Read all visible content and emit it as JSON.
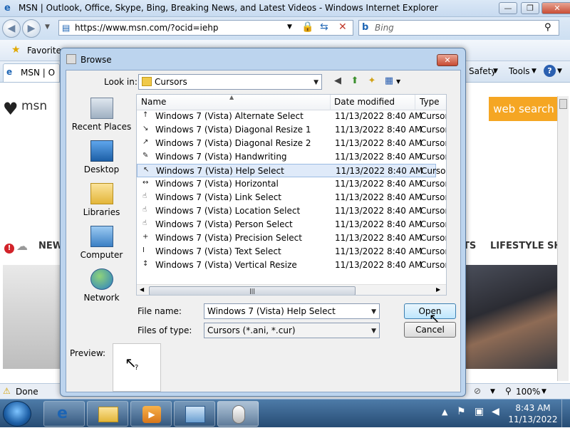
{
  "ie": {
    "title": "MSN | Outlook, Office, Skype, Bing, Breaking News, and Latest Videos - Windows Internet Explorer",
    "url": "https://www.msn.com/?ocid=iehp",
    "search_placeholder": "Bing",
    "favorites_label": "Favorites",
    "tab_label": "MSN | O",
    "safety_label": "Safety",
    "tools_label": "Tools",
    "status": "Done",
    "zoom": "100%"
  },
  "msn": {
    "logo": "msn",
    "web_search_label": "web search",
    "nav_new": "NEW",
    "nav_ts": "TS",
    "nav_lifestyle": "LIFESTYLE",
    "nav_sh": "SH"
  },
  "dialog": {
    "title": "Browse",
    "look_in_label": "Look in:",
    "look_in_value": "Cursors",
    "places": [
      {
        "label": "Recent Places",
        "icon": "recent-places-icon"
      },
      {
        "label": "Desktop",
        "icon": "desktop-icon"
      },
      {
        "label": "Libraries",
        "icon": "libraries-icon"
      },
      {
        "label": "Computer",
        "icon": "computer-icon"
      },
      {
        "label": "Network",
        "icon": "network-icon"
      }
    ],
    "columns": {
      "name": "Name",
      "date_modified": "Date modified",
      "type": "Type"
    },
    "files": [
      {
        "name": "Windows 7 (Vista) Alternate Select",
        "date": "11/13/2022 8:40 AM",
        "type": "Cursor",
        "glyph": "↑"
      },
      {
        "name": "Windows 7 (Vista) Diagonal Resize 1",
        "date": "11/13/2022 8:40 AM",
        "type": "Cursor",
        "glyph": "↘"
      },
      {
        "name": "Windows 7 (Vista) Diagonal Resize 2",
        "date": "11/13/2022 8:40 AM",
        "type": "Cursor",
        "glyph": "↗"
      },
      {
        "name": "Windows 7 (Vista) Handwriting",
        "date": "11/13/2022 8:40 AM",
        "type": "Cursor",
        "glyph": "✎"
      },
      {
        "name": "Windows 7 (Vista) Help Select",
        "date": "11/13/2022 8:40 AM",
        "type": "Cursor",
        "glyph": "↖"
      },
      {
        "name": "Windows 7 (Vista) Horizontal",
        "date": "11/13/2022 8:40 AM",
        "type": "Cursor",
        "glyph": "↔"
      },
      {
        "name": "Windows 7 (Vista) Link Select",
        "date": "11/13/2022 8:40 AM",
        "type": "Cursor",
        "glyph": "☝"
      },
      {
        "name": "Windows 7 (Vista) Location Select",
        "date": "11/13/2022 8:40 AM",
        "type": "Cursor",
        "glyph": "☝"
      },
      {
        "name": "Windows 7 (Vista) Person Select",
        "date": "11/13/2022 8:40 AM",
        "type": "Cursor",
        "glyph": "☝"
      },
      {
        "name": "Windows 7 (Vista) Precision Select",
        "date": "11/13/2022 8:40 AM",
        "type": "Cursor",
        "glyph": "+"
      },
      {
        "name": "Windows 7 (Vista) Text Select",
        "date": "11/13/2022 8:40 AM",
        "type": "Cursor",
        "glyph": "I"
      },
      {
        "name": "Windows 7 (Vista) Vertical Resize",
        "date": "11/13/2022 8:40 AM",
        "type": "Cursor",
        "glyph": "↕"
      }
    ],
    "selected_index": 4,
    "file_name_label": "File name:",
    "file_name_value": "Windows 7 (Vista) Help Select",
    "files_of_type_label": "Files of type:",
    "files_of_type_value": "Cursors (*.ani, *.cur)",
    "open_label": "Open",
    "cancel_label": "Cancel",
    "preview_label": "Preview:"
  },
  "taskbar": {
    "time": "8:43 AM",
    "date": "11/13/2022"
  },
  "colors": {
    "accent_orange": "#f5a623",
    "selection": "#dfeaf9"
  }
}
